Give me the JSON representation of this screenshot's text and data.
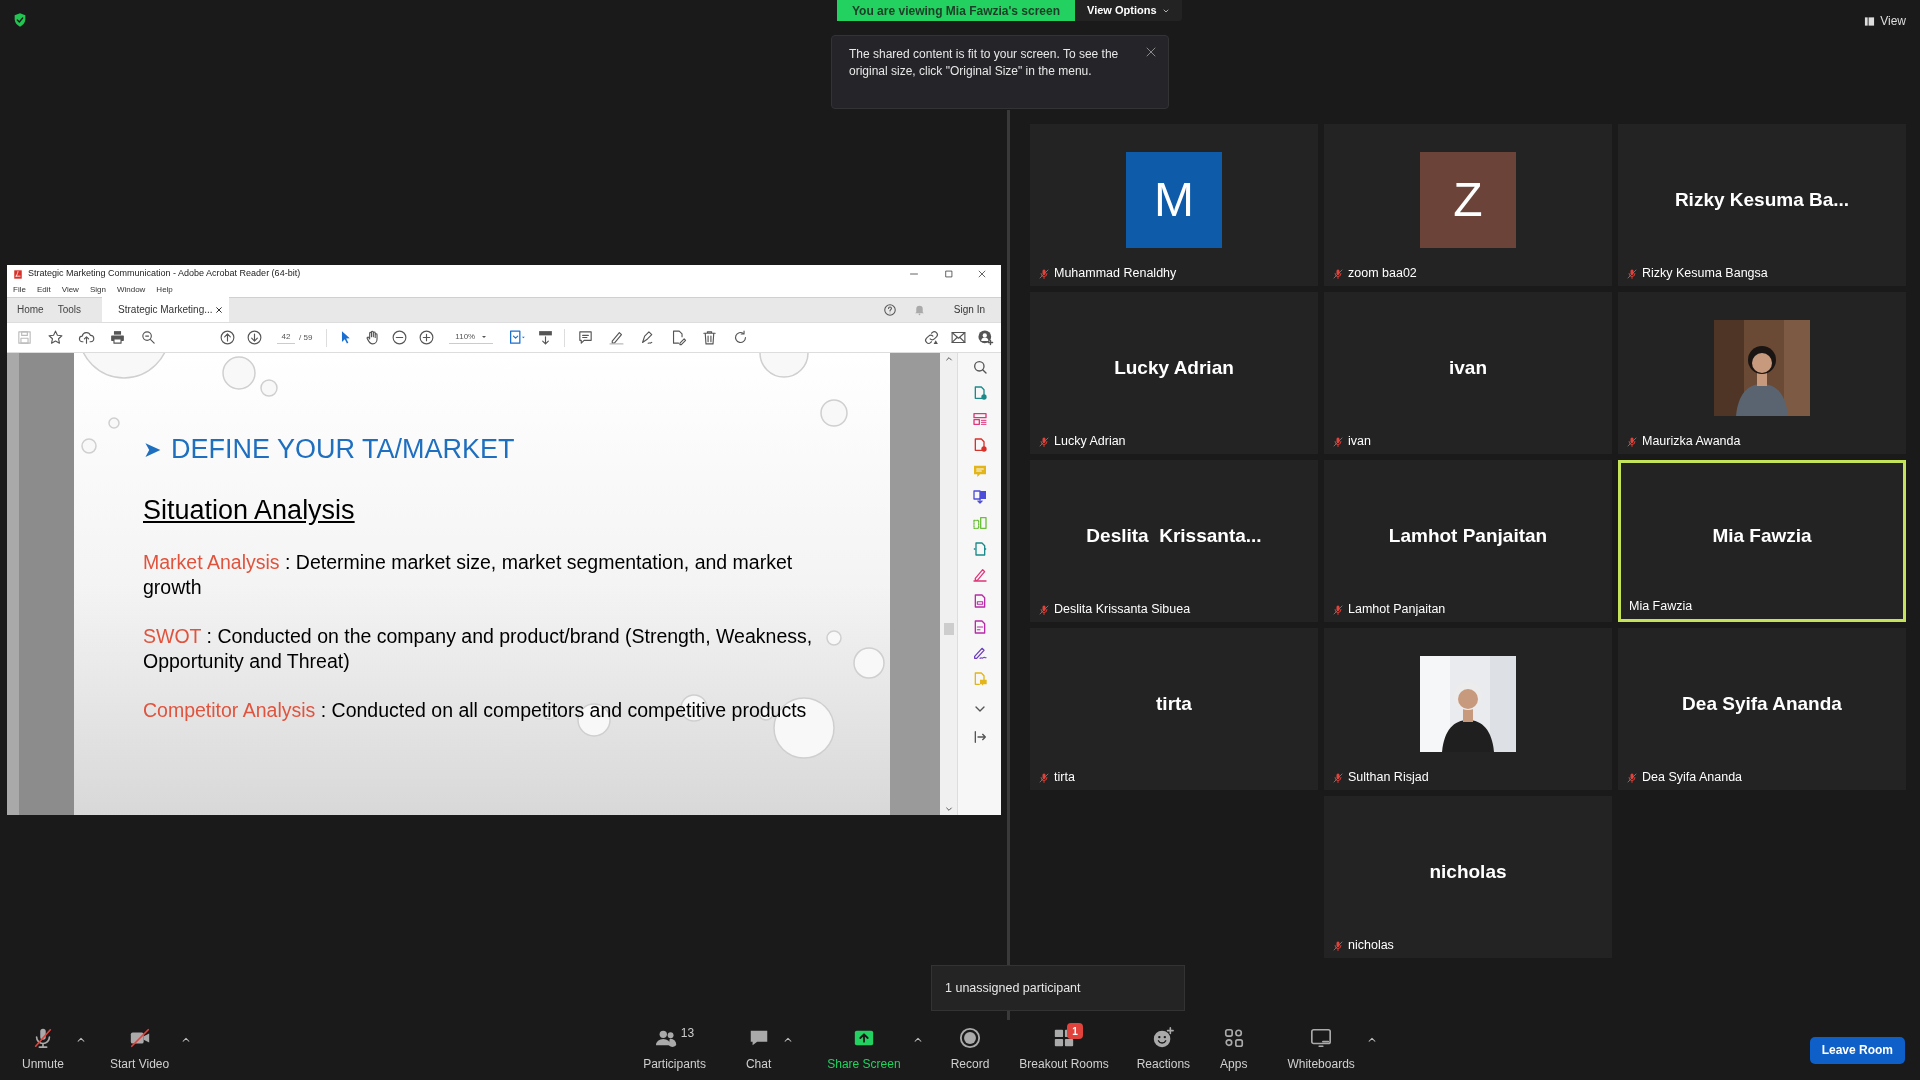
{
  "share_banner": {
    "text": "You are viewing Mia Fawzia's screen",
    "view_options": "View Options"
  },
  "fit_tooltip": {
    "text": "The shared content is fit to your screen. To see the original size, click \"Original Size\" in the menu."
  },
  "view_button": "View",
  "acrobat": {
    "title": "Strategic Marketing Communication - Adobe Acrobat Reader (64-bit)",
    "menu": [
      "File",
      "Edit",
      "View",
      "Sign",
      "Window",
      "Help"
    ],
    "tabs": [
      {
        "label": "Home",
        "selected": false
      },
      {
        "label": "Tools",
        "selected": false
      },
      {
        "label": "Strategic Marketing...",
        "selected": true
      }
    ],
    "sign_in": "Sign In",
    "page": "42",
    "page_total": "/ 59",
    "zoom": "110%",
    "slide": {
      "bullet": "➤",
      "heading": "DEFINE YOUR TA/MARKET",
      "subheading": "Situation Analysis",
      "items": [
        {
          "term": "Market Analysis",
          "text": " : Determine market size, market segmentation, and market growth"
        },
        {
          "term": "SWOT",
          "text": " : Conducted on the company and product/brand (Strength, Weakness, Opportunity and Threat)"
        },
        {
          "term": "Competitor Analysis",
          "text": " : Conducted on all competitors and competitive products"
        }
      ]
    }
  },
  "participants": [
    {
      "kind": "avatar",
      "display": "M",
      "color": "#0e5ba9",
      "label": "Muhammad Renaldhy",
      "muted": true,
      "speaking": false
    },
    {
      "kind": "avatar",
      "display": "Z",
      "color": "#6b4338",
      "label": "zoom baa02",
      "muted": true,
      "speaking": false
    },
    {
      "kind": "name",
      "display": "Rizky Kesuma Ba...",
      "label": "Rizky Kesuma Bangsa",
      "muted": true,
      "speaking": false
    },
    {
      "kind": "name",
      "display": "Lucky Adrian",
      "label": "Lucky Adrian",
      "muted": true,
      "speaking": false
    },
    {
      "kind": "name",
      "display": "ivan",
      "label": "ivan",
      "muted": true,
      "speaking": false
    },
    {
      "label": "Maurizka Awanda",
      "muted": true,
      "speaking": false
    },
    {
      "kind": "name",
      "display": "Deslita  Krissanta...",
      "label": "Deslita Krissanta Sibuea",
      "muted": true,
      "speaking": false
    },
    {
      "kind": "name",
      "display": "Lamhot Panjaitan",
      "label": "Lamhot Panjaitan",
      "muted": true,
      "speaking": false
    },
    {
      "kind": "name",
      "display": "Mia Fawzia",
      "label": "Mia Fawzia",
      "muted": false,
      "speaking": true
    },
    {
      "kind": "name",
      "display": "tirta",
      "label": "tirta",
      "muted": true,
      "speaking": false
    },
    {
      "label": "Sulthan Risjad",
      "muted": true,
      "speaking": false
    },
    {
      "kind": "name",
      "display": "Dea Syifa Ananda",
      "label": "Dea Syifa Ananda",
      "muted": true,
      "speaking": false
    },
    {
      "kind": "name",
      "display": "nicholas",
      "label": "nicholas",
      "muted": true,
      "speaking": false
    }
  ],
  "unassigned_tooltip": "1 unassigned participant",
  "toolbar": [
    {
      "kind": "mic",
      "label": "Unmute",
      "caret": true
    },
    {
      "kind": "video",
      "label": "Start Video",
      "caret": true
    },
    {
      "kind": "participants",
      "label": "Participants",
      "count": "13",
      "caret": false
    },
    {
      "kind": "chat",
      "label": "Chat",
      "caret": true
    },
    {
      "kind": "share",
      "label": "Share Screen",
      "caret": true
    },
    {
      "kind": "record",
      "label": "Record",
      "caret": false
    },
    {
      "kind": "breakout",
      "label": "Breakout Rooms",
      "badge": "1",
      "caret": false
    },
    {
      "kind": "reactions",
      "label": "Reactions",
      "caret": false
    },
    {
      "kind": "apps",
      "label": "Apps",
      "caret": false
    },
    {
      "kind": "whiteboards",
      "label": "Whiteboards",
      "caret": true
    }
  ],
  "leave_button": "Leave Room"
}
